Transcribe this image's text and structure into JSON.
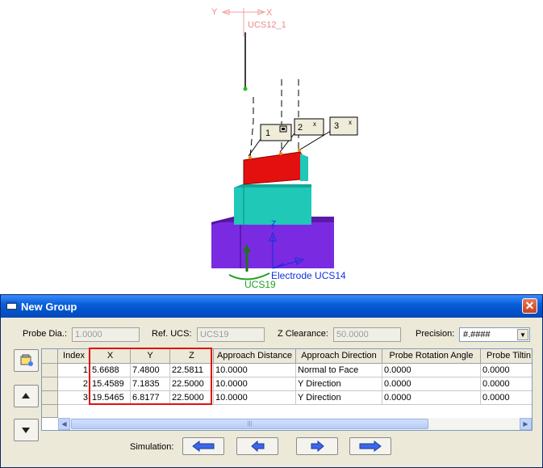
{
  "scene": {
    "ucs_top": "UCS12_1",
    "axis_y": "Y",
    "axis_x": "X",
    "axis_z": "Z",
    "electrode_ucs": "Electrode UCS14",
    "ucs_bottom": "UCS19",
    "probe_labels": [
      "1",
      "2",
      "3"
    ]
  },
  "dialog": {
    "title": "New Group",
    "close_glyph": "✕",
    "probe_dia_label": "Probe Dia.:",
    "probe_dia_value": "1.0000",
    "ref_ucs_label": "Ref. UCS:",
    "ref_ucs_value": "UCS19",
    "z_clearance_label": "Z Clearance:",
    "z_clearance_value": "50.0000",
    "precision_label": "Precision:",
    "precision_value": "#.####",
    "simulation_label": "Simulation:"
  },
  "table": {
    "columns": [
      "Index",
      "X",
      "Y",
      "Z",
      "Approach Distance",
      "Approach Direction",
      "Probe Rotation Angle",
      "Probe Tiltin"
    ],
    "rows": [
      {
        "index": "1",
        "x": "5.6688",
        "y": "7.4800",
        "z": "22.5811",
        "dist": "10.0000",
        "dir": "Normal to Face",
        "rot": "0.0000",
        "tilt": "0.0000"
      },
      {
        "index": "2",
        "x": "15.4589",
        "y": "7.1835",
        "z": "22.5000",
        "dist": "10.0000",
        "dir": "Y Direction",
        "rot": "0.0000",
        "tilt": "0.0000"
      },
      {
        "index": "3",
        "x": "19.5465",
        "y": "6.8177",
        "z": "22.5000",
        "dist": "10.0000",
        "dir": "Y Direction",
        "rot": "0.0000",
        "tilt": "0.0000"
      }
    ]
  },
  "colors": {
    "electrode_red": "#e41010",
    "holder_cyan": "#20c8b8",
    "base_purple": "#7a2ae0",
    "highlight_red": "#e01010"
  }
}
